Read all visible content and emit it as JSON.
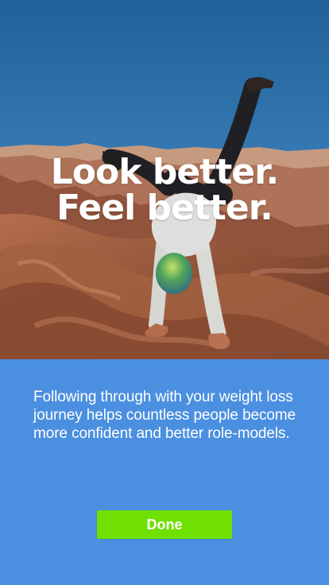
{
  "hero": {
    "headline_line_1": "Look better.",
    "headline_line_2": "Feel better.",
    "image_name": "handstand-canyon-photo"
  },
  "content": {
    "message": "Following through with your weight loss journey helps countless people become more confident and better role-models."
  },
  "actions": {
    "done_label": "Done"
  },
  "colors": {
    "background": "#4b8fe0",
    "button": "#6fe000",
    "text": "#ffffff"
  }
}
